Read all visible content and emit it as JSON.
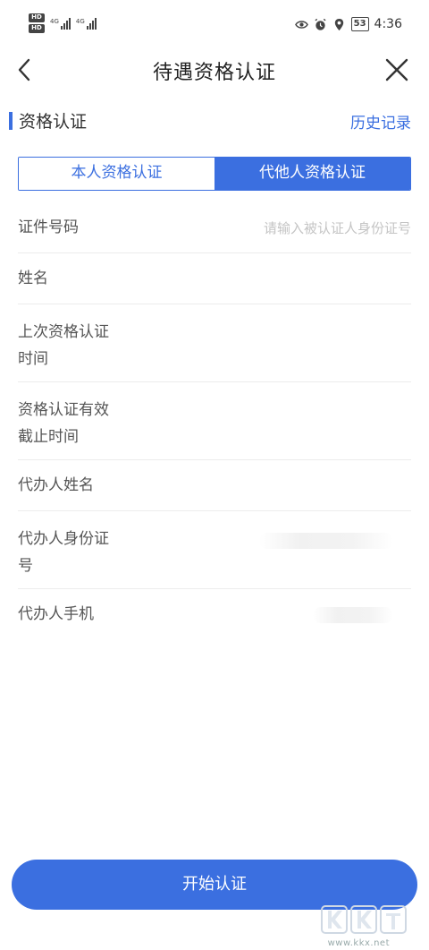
{
  "status_bar": {
    "sim_badges": [
      "HD",
      "HD"
    ],
    "network_labels": [
      "4G",
      "4G"
    ],
    "battery": "53",
    "time": "4:36"
  },
  "header": {
    "title": "待遇资格认证"
  },
  "section": {
    "title": "资格认证",
    "history_link": "历史记录"
  },
  "tabs": [
    {
      "label": "本人资格认证",
      "active": false
    },
    {
      "label": "代他人资格认证",
      "active": true
    }
  ],
  "form": {
    "id_number": {
      "label": "证件号码",
      "placeholder": "请输入被认证人身份证号"
    },
    "name": {
      "label": "姓名"
    },
    "last_cert_time": {
      "label": "上次资格认证时间"
    },
    "valid_until": {
      "label": "资格认证有效截止时间"
    },
    "agent_name": {
      "label": "代办人姓名"
    },
    "agent_id": {
      "label": "代办人身份证号"
    },
    "agent_phone": {
      "label": "代办人手机"
    }
  },
  "submit": {
    "label": "开始认证"
  },
  "colors": {
    "accent": "#3b6fe0",
    "divider": "#ececec",
    "placeholder": "#c4c4c4"
  },
  "watermark": {
    "url": "www.kkx.net"
  }
}
